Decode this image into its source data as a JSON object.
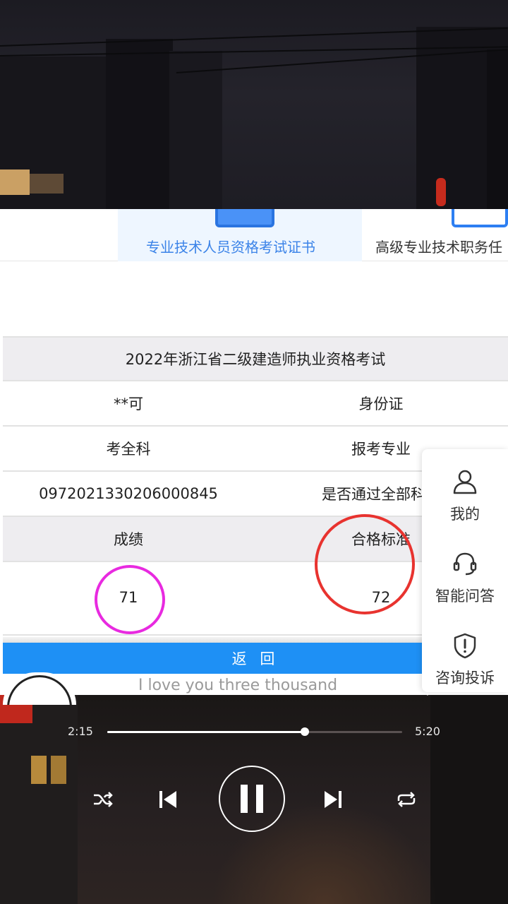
{
  "tabs": [
    {
      "label": "专业技术人员资格考试证书",
      "active": true
    },
    {
      "label": "高级专业技术职务任",
      "active": false
    }
  ],
  "exam": {
    "title": "2022年浙江省二级建造师执业资格考试",
    "rows": [
      {
        "left": "**可",
        "right": "身份证",
        "shaded": false
      },
      {
        "left": "考全科",
        "right": "报考专业",
        "shaded": false
      },
      {
        "left": "097202133020600084​5",
        "right": "是否通过全部科目",
        "shaded": false
      },
      {
        "left": "成绩",
        "right": "合格标准",
        "shaded": true
      },
      {
        "left": "71",
        "right": "72",
        "shaded": false
      }
    ]
  },
  "back_button": "返 回",
  "side_menu": [
    {
      "icon": "user-icon",
      "label": "我的"
    },
    {
      "icon": "headset-icon",
      "label": "智能问答"
    },
    {
      "icon": "shield-icon",
      "label": "咨询投诉"
    }
  ],
  "annotations": {
    "score_circle_color": "#e82ae0",
    "standard_circle_color": "#e8332f"
  },
  "player": {
    "lyric": "I love you three thousand",
    "current_time": "2:15",
    "total_time": "5:20",
    "progress_fraction": 0.671,
    "state": "playing"
  },
  "colors": {
    "accent": "#1e90f5",
    "tab_active_text": "#3b83e8"
  }
}
